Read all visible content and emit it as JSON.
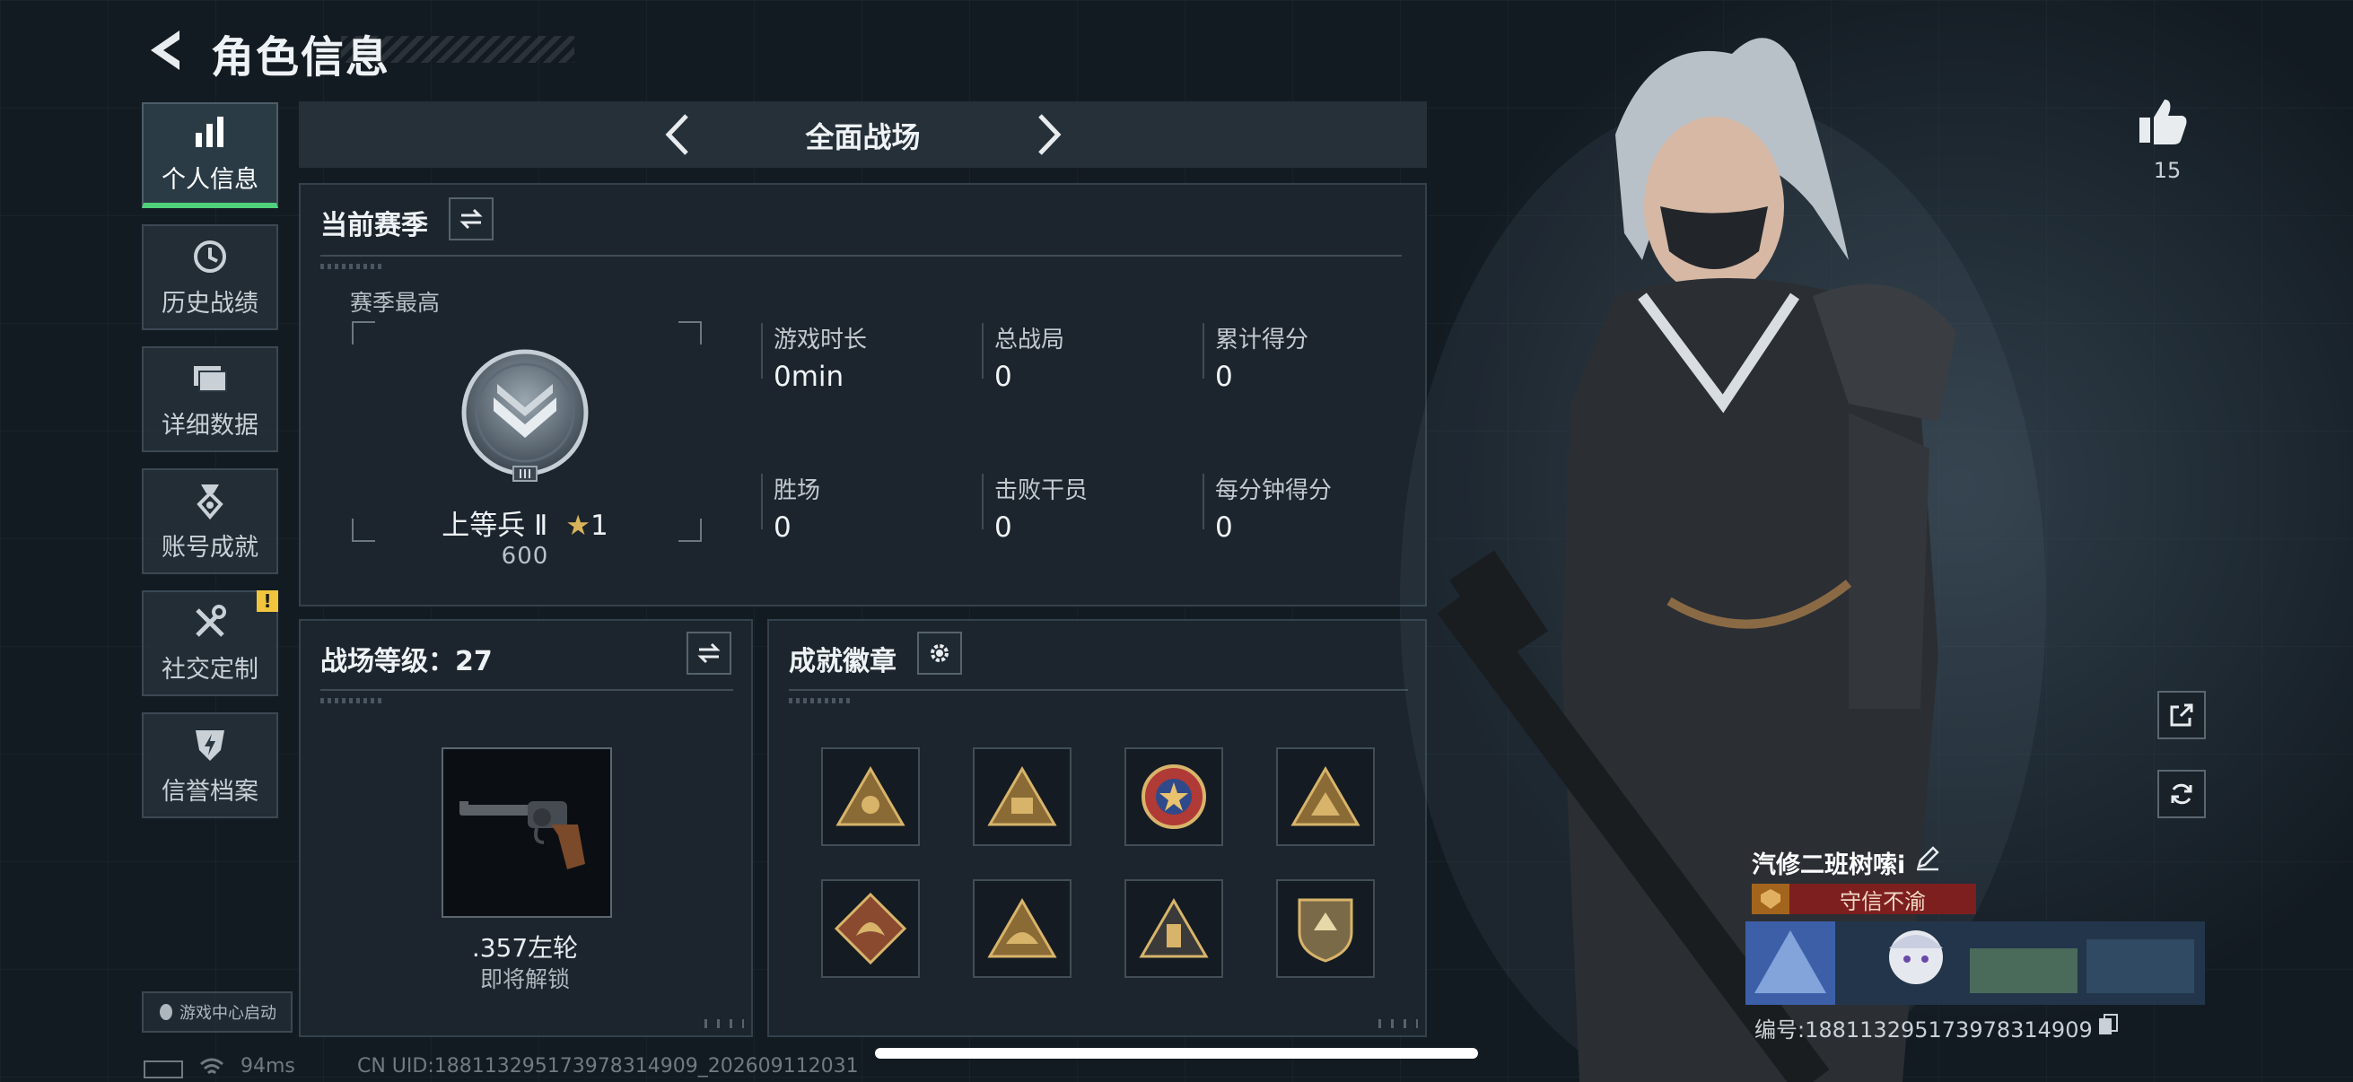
{
  "header": {
    "title": "角色信息"
  },
  "sidebar": {
    "items": [
      {
        "label": "个人信息",
        "icon": "bar-chart-icon",
        "active": true
      },
      {
        "label": "历史战绩",
        "icon": "clock-icon",
        "active": false
      },
      {
        "label": "详细数据",
        "icon": "folder-icon",
        "active": false
      },
      {
        "label": "账号成就",
        "icon": "medal-icon",
        "active": false
      },
      {
        "label": "社交定制",
        "icon": "tools-icon",
        "active": false,
        "badge": "!"
      },
      {
        "label": "信誉档案",
        "icon": "shield-bolt-icon",
        "active": false
      }
    ],
    "game_center": "游戏中心启动"
  },
  "mode": {
    "title": "全面战场"
  },
  "season": {
    "heading": "当前赛季",
    "best_label": "赛季最高",
    "rank_name": "上等兵 Ⅱ",
    "rank_stars": "1",
    "rank_score": "600",
    "stats": [
      {
        "label": "游戏时长",
        "value": "0min"
      },
      {
        "label": "总战局",
        "value": "0"
      },
      {
        "label": "累计得分",
        "value": "0"
      },
      {
        "label": "胜场",
        "value": "0"
      },
      {
        "label": "击败干员",
        "value": "0"
      },
      {
        "label": "每分钟得分",
        "value": "0"
      }
    ]
  },
  "level": {
    "heading": "战场等级：27",
    "weapon_name": ".357左轮",
    "weapon_status": "即将解锁"
  },
  "badges": {
    "heading": "成就徽章",
    "items": [
      "triangle-badge-icon",
      "triangle-badge-icon",
      "star-seal-badge-icon",
      "triangle-badge-icon",
      "dragon-badge-icon",
      "triangle-badge-icon",
      "triangle-badge-icon",
      "shield-badge-icon"
    ]
  },
  "profile": {
    "likes": "15",
    "player_name": "汽修二班树嗦i",
    "title": "守信不渝",
    "id_text": "编号:1881132951739783149​09"
  },
  "status_bar": {
    "ping": "94ms",
    "uid": "CN UID:18811329517397831490​9_202609112031"
  },
  "colors": {
    "accent": "#4fd07a",
    "badge_gold": "#c9a25a",
    "title_red": "#7e1f1f"
  }
}
